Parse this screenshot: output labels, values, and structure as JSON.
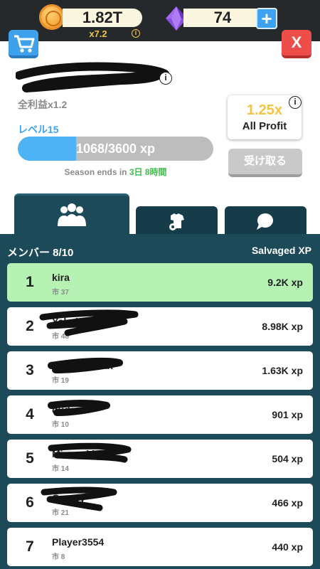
{
  "currency": {
    "coins": "1.82T",
    "multiplier": "x7.2",
    "gems": "74",
    "info_symbol": "i",
    "plus_label": "+"
  },
  "header": {
    "close_label": "X",
    "info_symbol": "i"
  },
  "profile": {
    "bonus": "全利益x1.2",
    "level": "レベル15",
    "xp_text": "1068/3600 xp",
    "xp_progress": 0.2967,
    "season_prefix": "Season ends in ",
    "season_time": "3日 8時間"
  },
  "profit_card": {
    "value": "1.25x",
    "label": "All Profit",
    "info_symbol": "i"
  },
  "claim_button": {
    "label": "受け取る"
  },
  "tabs": [
    {
      "icon": "members-icon",
      "active": true
    },
    {
      "icon": "shirt-gear-icon",
      "active": false
    },
    {
      "icon": "chat-icon",
      "active": false
    }
  ],
  "panel": {
    "members_count": "メンバー 8/10",
    "xp_header": "Salvaged XP"
  },
  "members": [
    {
      "rank": "1",
      "name": "kira",
      "city": "市 37",
      "xp": "9.2K xp",
      "highlight": true
    },
    {
      "rank": "2",
      "name": "Yakult",
      "city": "市 48",
      "xp": "8.98K xp"
    },
    {
      "rank": "3",
      "name": "Yorozuyasan",
      "city": "市 19",
      "xp": "1.63K xp"
    },
    {
      "rank": "4",
      "name": "duda",
      "city": "市 10",
      "xp": "901 xp"
    },
    {
      "rank": "5",
      "name": "Mizunoki",
      "city": "市 14",
      "xp": "504 xp"
    },
    {
      "rank": "6",
      "name": "Gamey",
      "city": "市 21",
      "xp": "466 xp"
    },
    {
      "rank": "7",
      "name": "Player3554",
      "city": "市 8",
      "xp": "440 xp"
    }
  ],
  "colors": {
    "topbar": "#26292c",
    "coin_gold": "#f4c542",
    "accent_blue": "#3ea2f0",
    "close_red": "#ee4e4a",
    "panel_teal": "#1c4a59",
    "highlight_green": "#b5f2b3",
    "season_green": "#3fbf4c"
  }
}
